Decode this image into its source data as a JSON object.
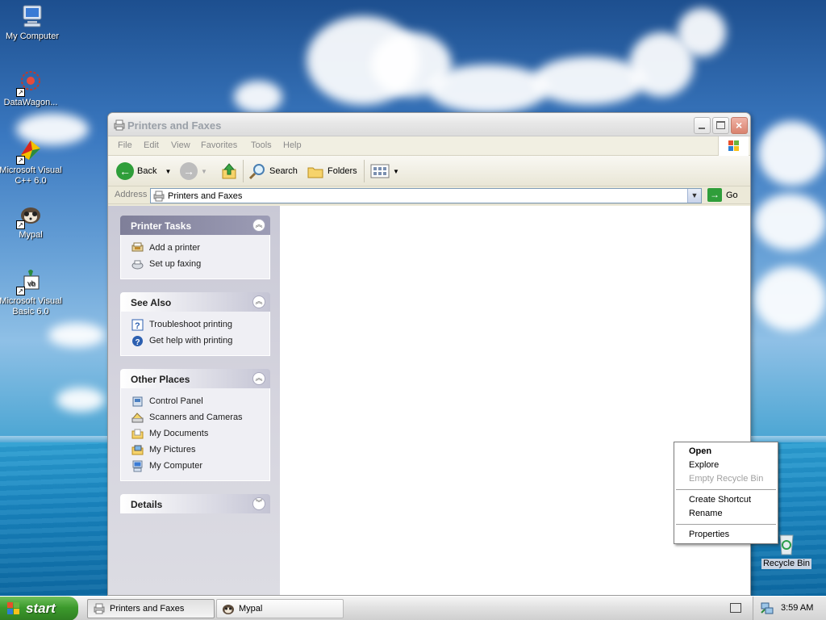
{
  "desktop": {
    "icons": [
      {
        "label": "My Computer"
      },
      {
        "label": "DataWagon..."
      },
      {
        "label": "Microsoft Visual C++ 6.0"
      },
      {
        "label": "Mypal"
      },
      {
        "label": "Microsoft Visual Basic 6.0"
      },
      {
        "label": "Recycle Bin"
      }
    ]
  },
  "window": {
    "title": "Printers and Faxes",
    "menu": [
      "File",
      "Edit",
      "View",
      "Favorites",
      "Tools",
      "Help"
    ],
    "toolbar": {
      "back": "Back",
      "search": "Search",
      "folders": "Folders"
    },
    "address": {
      "label": "Address",
      "value": "Printers and Faxes",
      "go": "Go"
    },
    "panels": [
      {
        "title": "Printer Tasks",
        "items": [
          "Add a printer",
          "Set up faxing"
        ]
      },
      {
        "title": "See Also",
        "items": [
          "Troubleshoot printing",
          "Get help with printing"
        ]
      },
      {
        "title": "Other Places",
        "items": [
          "Control Panel",
          "Scanners and Cameras",
          "My Documents",
          "My Pictures",
          "My Computer"
        ]
      },
      {
        "title": "Details",
        "items": []
      }
    ]
  },
  "context_menu": {
    "items": [
      "Open",
      "Explore",
      "Empty Recycle Bin",
      "Create Shortcut",
      "Rename",
      "Properties"
    ]
  },
  "taskbar": {
    "start": "start",
    "tasks": [
      "Printers and Faxes",
      "Mypal"
    ],
    "clock": "3:59 AM"
  },
  "colors": {
    "start_green": "#3c9a2c",
    "address_border": "#7f9db9"
  }
}
